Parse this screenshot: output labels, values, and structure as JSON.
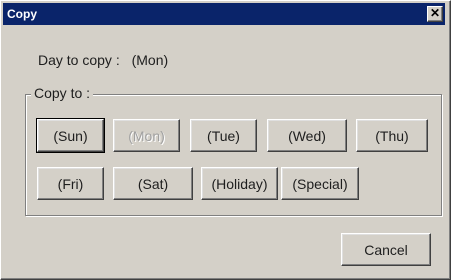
{
  "window": {
    "title": "Copy",
    "close_glyph": "✕"
  },
  "day": {
    "label": "Day to copy :",
    "value": "(Mon)"
  },
  "group": {
    "label": "Copy to :"
  },
  "buttons": {
    "sun": "(Sun)",
    "mon": "(Mon)",
    "tue": "(Tue)",
    "wed": "(Wed)",
    "thu": "(Thu)",
    "fri": "(Fri)",
    "sat": "(Sat)",
    "holiday": "(Holiday)",
    "special": "(Special)",
    "cancel": "Cancel"
  }
}
